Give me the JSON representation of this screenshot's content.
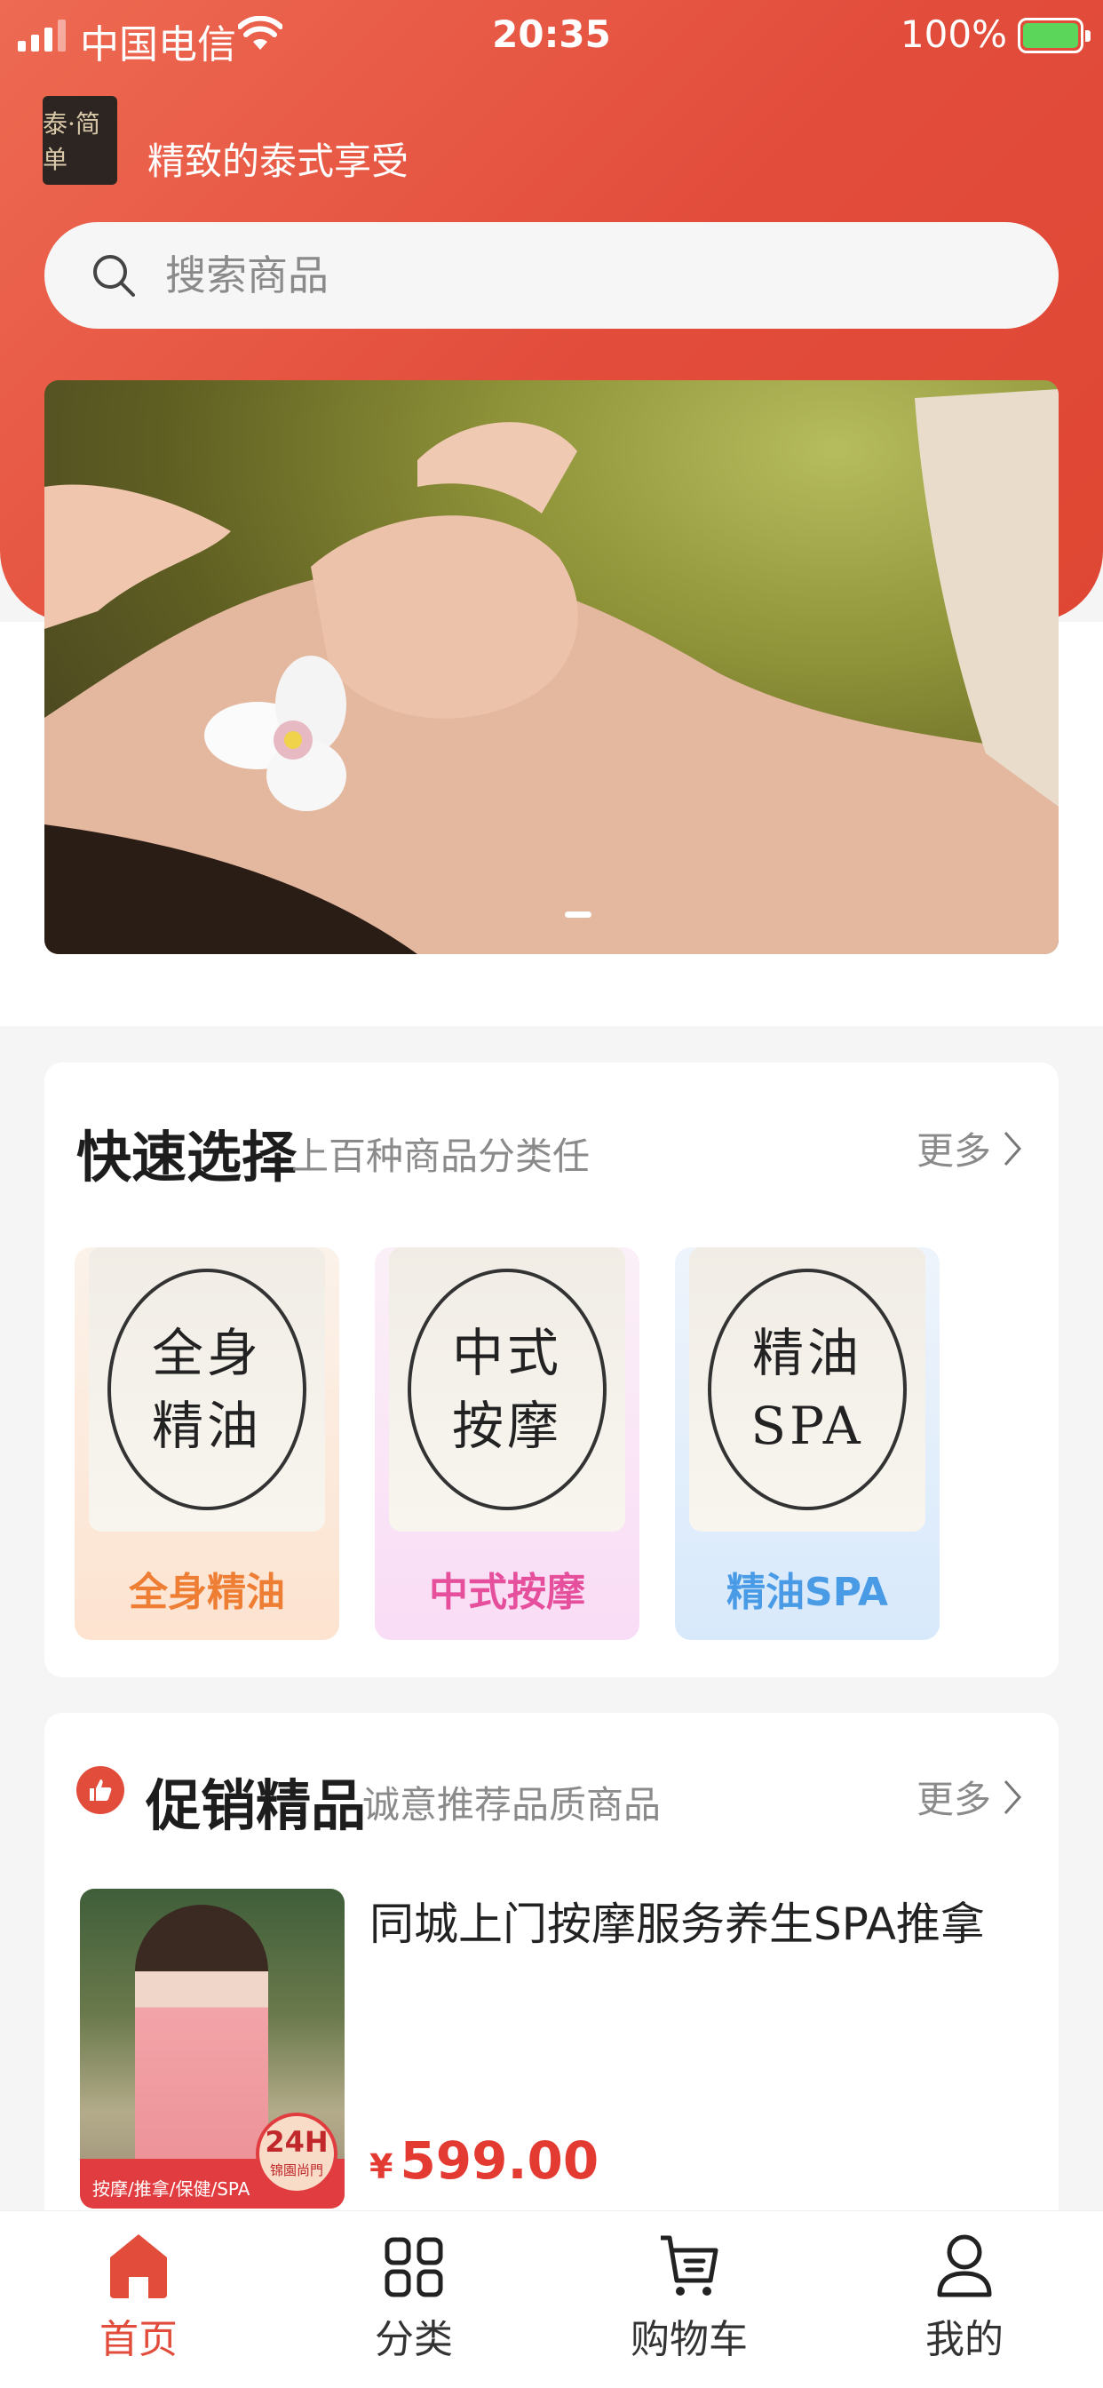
{
  "status_bar": {
    "carrier": "中国电信",
    "time": "20:35",
    "battery": "100%"
  },
  "brand": {
    "logo_text": "泰·简单",
    "tagline": "精致的泰式享受"
  },
  "search": {
    "placeholder": "搜索商品"
  },
  "banner": {
    "image": "spa-facial-massage-woman-orchid",
    "indicator_count": 1
  },
  "quick_select": {
    "title": "快速选择",
    "subtitle": "上百种商品分类任",
    "more": "更多",
    "items": [
      {
        "icon_line1": "全身",
        "icon_line2": "精油",
        "label": "全身精油",
        "color": "#ef7e35"
      },
      {
        "icon_line1": "中式",
        "icon_line2": "按摩",
        "label": "中式按摩",
        "color": "#e54f9c"
      },
      {
        "icon_line1": "精油",
        "icon_line2": "SPA",
        "label": "精油SPA",
        "color": "#4a9be6"
      }
    ]
  },
  "promo": {
    "title": "促销精品",
    "subtitle": "诚意推荐品质商品",
    "more": "更多",
    "product": {
      "title": "同城上门按摩服务养生SPA推拿",
      "currency": "¥",
      "price": "599.00",
      "image_strip": "按摩/推拿/保健/SPA",
      "image_badge": "24H",
      "image_badge_sub": "锦園尚門"
    }
  },
  "tabbar": {
    "items": [
      {
        "label": "首页",
        "icon": "home-icon",
        "active": true
      },
      {
        "label": "分类",
        "icon": "grid-icon",
        "active": false
      },
      {
        "label": "购物车",
        "icon": "cart-icon",
        "active": false
      },
      {
        "label": "我的",
        "icon": "user-icon",
        "active": false
      }
    ]
  },
  "colors": {
    "accent": "#e24c3b",
    "price": "#e33a31"
  }
}
